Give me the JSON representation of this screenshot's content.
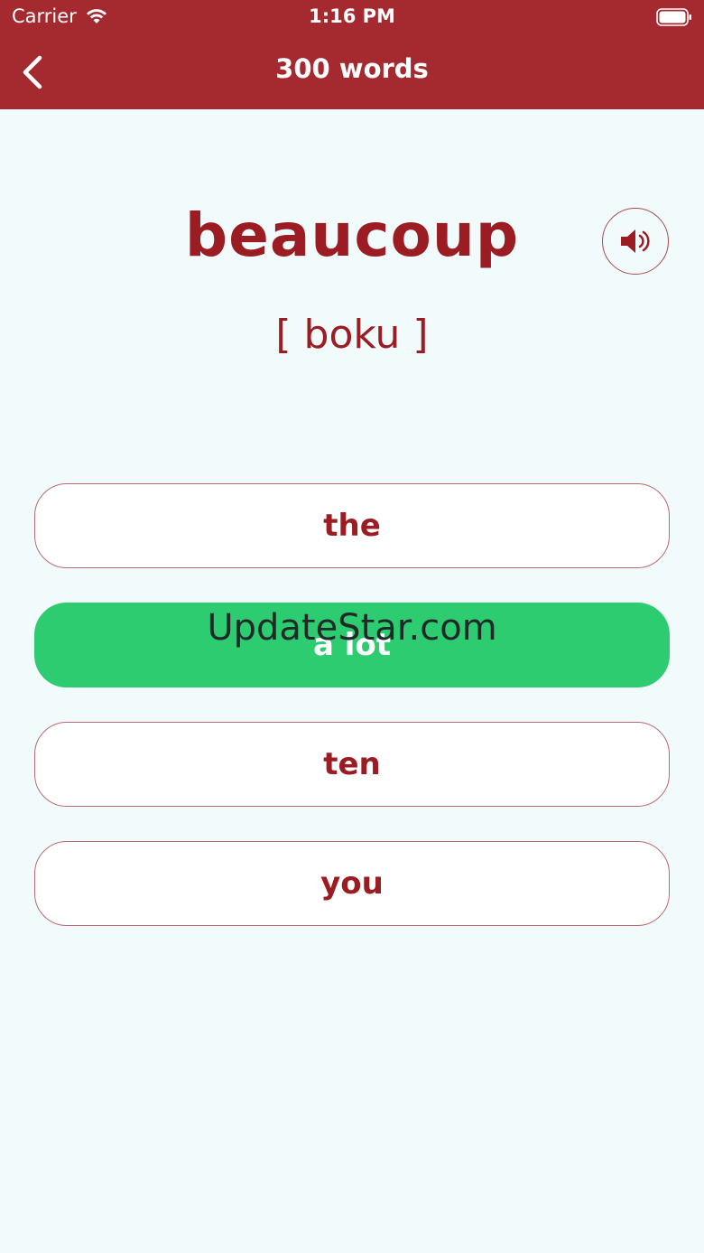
{
  "status_bar": {
    "carrier": "Carrier",
    "time": "1:16 PM"
  },
  "nav": {
    "title": "300 words"
  },
  "quiz": {
    "word": "beaucoup",
    "pronunciation": "[ boku ]",
    "answers": [
      {
        "label": "the",
        "state": "default"
      },
      {
        "label": "a lot",
        "state": "correct"
      },
      {
        "label": "ten",
        "state": "default"
      },
      {
        "label": "you",
        "state": "default"
      }
    ]
  },
  "watermark": "UpdateStar.com",
  "colors": {
    "header": "#a52a30",
    "accent": "#9b1c22",
    "correct": "#2ecc71",
    "background": "#f1fbfb"
  },
  "icons": {
    "back": "chevron-left-icon",
    "speaker": "speaker-icon",
    "wifi": "wifi-icon",
    "battery": "battery-icon"
  }
}
